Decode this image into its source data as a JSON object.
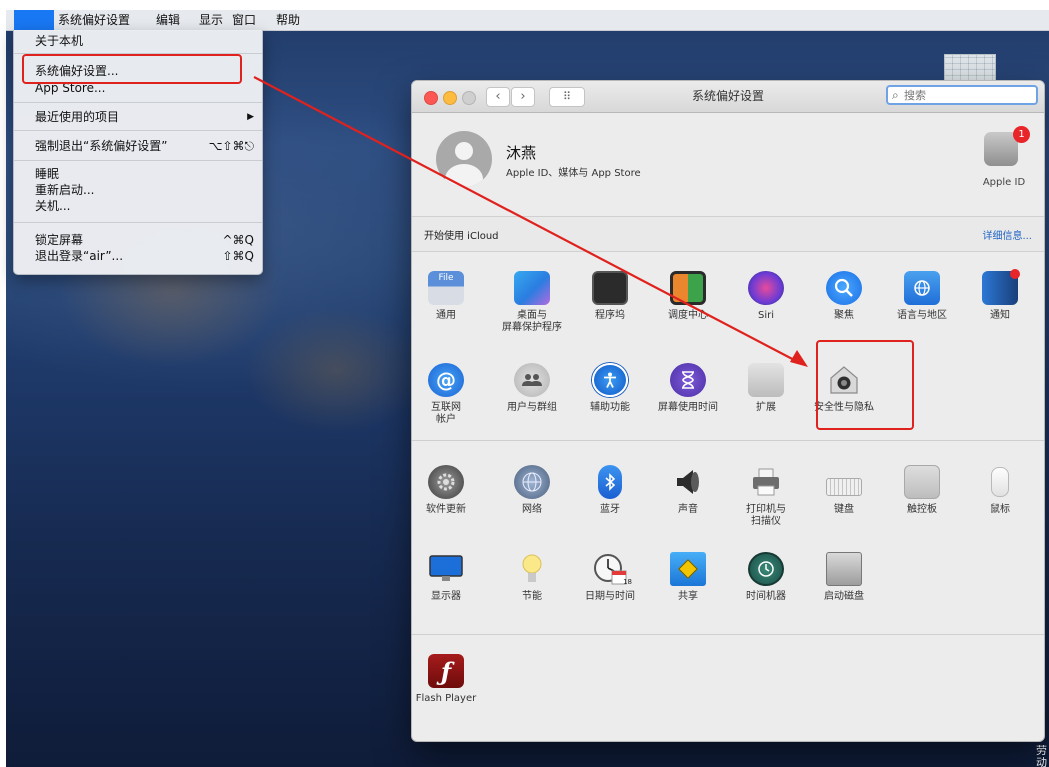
{
  "menubar": {
    "apple_glyph": "",
    "items": [
      "系统偏好设置",
      "编辑",
      "显示",
      "窗口",
      "帮助"
    ]
  },
  "apple_menu": {
    "about": "关于本机",
    "system_prefs": "系统偏好设置...",
    "app_store": "App Store...",
    "recent_items": "最近使用的项目",
    "recent_arrow": "▶",
    "force_quit": "强制退出“系统偏好设置”",
    "force_quit_shortcut": "⌥⇧⌘⎋",
    "sleep": "睡眠",
    "restart": "重新启动...",
    "shutdown": "关机...",
    "lock_screen": "锁定屏幕",
    "lock_shortcut": "^⌘Q",
    "logout": "退出登录“air”...",
    "logout_shortcut": "⇧⌘Q"
  },
  "window": {
    "title": "系统偏好设置",
    "back": "‹",
    "forward": "›",
    "grid": "⠿",
    "search_icon": "⌕",
    "search_placeholder": "搜索"
  },
  "account": {
    "name": "沐燕",
    "subtitle": "Apple ID、媒体与 App Store",
    "appleid_label": "Apple ID",
    "badge": "1"
  },
  "icloud": {
    "label": "开始使用 iCloud",
    "details": "详细信息..."
  },
  "panes": {
    "general": "通用",
    "desktop": "桌面与\n屏幕保护程序",
    "dock": "程序坞",
    "mission": "调度中心",
    "siri": "Siri",
    "spotlight": "聚焦",
    "language": "语言与地区",
    "notifications": "通知",
    "internet": "互联网\n帐户",
    "users": "用户与群组",
    "accessibility": "辅助功能",
    "screentime": "屏幕使用时间",
    "extensions": "扩展",
    "security": "安全性与隐私",
    "software_update": "软件更新",
    "network": "网络",
    "bluetooth": "蓝牙",
    "sound": "声音",
    "printers": "打印机与\n扫描仪",
    "keyboard": "键盘",
    "trackpad": "触控板",
    "mouse": "鼠标",
    "displays": "显示器",
    "energy": "节能",
    "datetime": "日期与时间",
    "sharing": "共享",
    "timemachine": "时间机器",
    "startup": "启动磁盘",
    "flash": "Flash Player"
  },
  "icon_text": {
    "general_file": "File",
    "calendar_day": "18",
    "at": "@",
    "flash_glyph": "ƒ"
  },
  "colors": {
    "highlight_red": "#e0221e",
    "menu_highlight": "#1877f2",
    "link_blue": "#1f63c5"
  },
  "desktop": {
    "corner_text": "劳动 共享"
  }
}
